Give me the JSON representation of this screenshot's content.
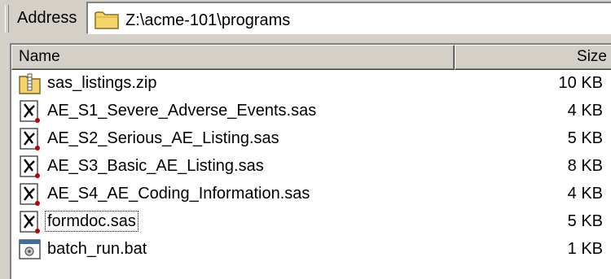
{
  "address": {
    "label": "Address",
    "path": "Z:\\acme-101\\programs"
  },
  "list": {
    "columns": {
      "name": "Name",
      "size": "Size"
    },
    "files": [
      {
        "name": "sas_listings.zip",
        "size": "10 KB",
        "icon": "zip-folder-icon"
      },
      {
        "name": "AE_S1_Severe_Adverse_Events.sas",
        "size": "4 KB",
        "icon": "sas-file-icon"
      },
      {
        "name": "AE_S2_Serious_AE_Listing.sas",
        "size": "5 KB",
        "icon": "sas-file-icon"
      },
      {
        "name": "AE_S3_Basic_AE_Listing.sas",
        "size": "8 KB",
        "icon": "sas-file-icon"
      },
      {
        "name": "AE_S4_AE_Coding_Information.sas",
        "size": "4 KB",
        "icon": "sas-file-icon"
      },
      {
        "name": "formdoc.sas",
        "size": "5 KB",
        "icon": "sas-file-icon",
        "focused": true
      },
      {
        "name": "batch_run.bat",
        "size": "1 KB",
        "icon": "batch-file-icon"
      }
    ]
  }
}
